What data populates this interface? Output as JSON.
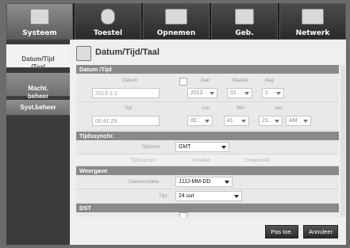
{
  "tabs": [
    {
      "label": "Systeem",
      "icon": "monitor-icon"
    },
    {
      "label": "Toestel",
      "icon": "camera-icon"
    },
    {
      "label": "Opnemen",
      "icon": "rec-icon"
    },
    {
      "label": "Geb.",
      "icon": "event-icon"
    },
    {
      "label": "Netwerk",
      "icon": "network-icon"
    }
  ],
  "sidebar": {
    "items": [
      {
        "label": "Datum/Tijd\n/Taal"
      },
      {
        "label": "Macht.\nbeheer"
      },
      {
        "label": "Syst.beheer"
      }
    ]
  },
  "panel": {
    "title": "Datum/Tijd/Taal"
  },
  "sections": {
    "datum_tijd": "Datum /Tijd",
    "tijdssynchr": "Tijdssynchr.",
    "weergave": "Weergave",
    "dst": "DST"
  },
  "date": {
    "label": "Datum",
    "value": "2013-1-1",
    "year_label": "Jaar",
    "month_label": "Maand",
    "day_label": "dag",
    "year": "2013",
    "month": "01",
    "day": "1"
  },
  "time": {
    "label": "Tijd",
    "value": "00:41:28",
    "hour_label": "Uur",
    "min_label": "Min",
    "sec_label": "sec.",
    "hour": "00",
    "min": "41",
    "sec": "23",
    "ampm": "AM"
  },
  "sync": {
    "timezone_label": "Tijdzone",
    "timezone": "GMT",
    "sync_label": "Tijdssynchr.",
    "setup": "Instellen",
    "status": "Ongebruikt"
  },
  "display": {
    "date_format_label": "Datumnotatie",
    "date_format": "JJJJ-MM-DD",
    "time_label": "Tijd",
    "time_format": "24 uur"
  },
  "buttons": {
    "apply": "Pas toe.",
    "cancel": "Annuleer"
  }
}
